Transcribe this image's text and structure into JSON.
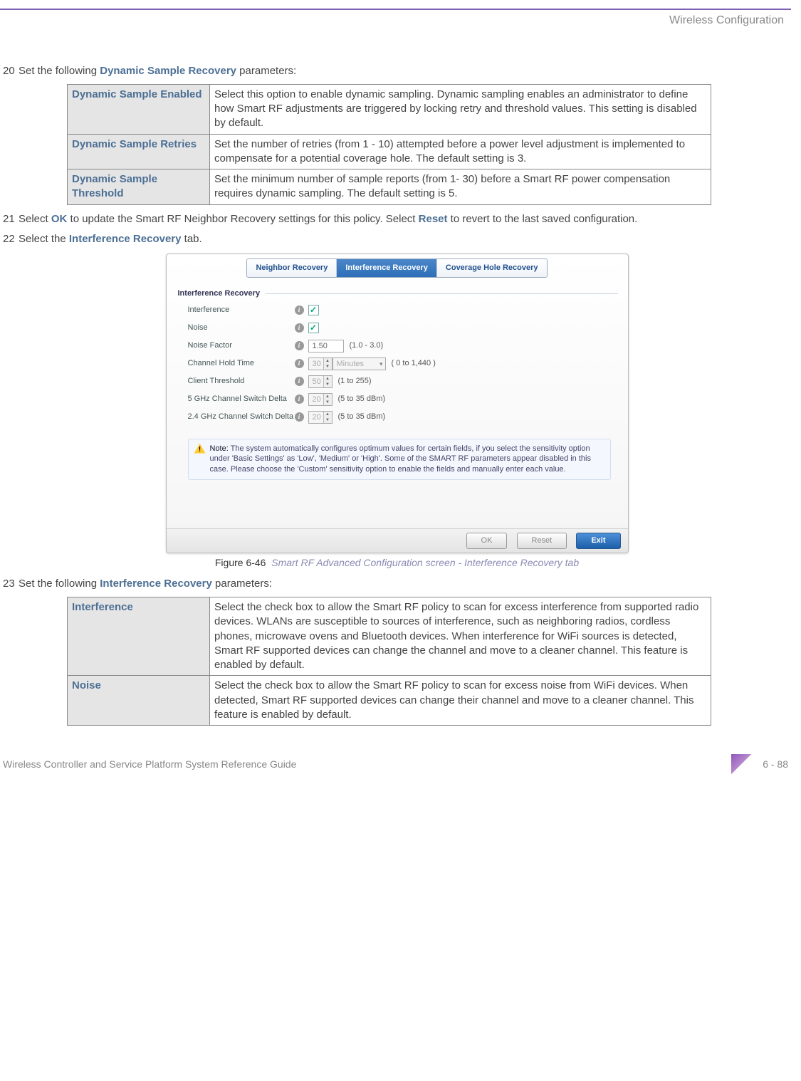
{
  "header": {
    "section_title": "Wireless Configuration"
  },
  "steps": {
    "s20": {
      "num": "20",
      "prefix": "Set the following ",
      "bold": "Dynamic Sample Recovery",
      "suffix": " parameters:"
    },
    "s21": {
      "num": "21",
      "t1": " Select ",
      "ok": "OK",
      "t2": " to update the Smart RF Neighbor Recovery settings for this policy. Select ",
      "reset": "Reset",
      "t3": " to revert to the last saved configuration."
    },
    "s22": {
      "num": "22",
      "prefix": "Select the ",
      "bold": "Interference Recovery",
      "suffix": " tab."
    },
    "s23": {
      "num": "23",
      "prefix": "Set the following ",
      "bold": "Interference Recovery",
      "suffix": " parameters:"
    }
  },
  "table1": {
    "r1": {
      "label": "Dynamic Sample Enabled",
      "desc": "Select this option to enable dynamic sampling. Dynamic sampling enables an administrator to define how Smart RF adjustments are triggered by locking retry and threshold values. This setting is disabled by default."
    },
    "r2": {
      "label": "Dynamic Sample Retries",
      "desc": "Set the number of retries (from 1 - 10) attempted before a power level adjustment is implemented to compensate for a potential coverage hole. The default setting is 3."
    },
    "r3": {
      "label": "Dynamic Sample Threshold",
      "desc": "Set the minimum number of sample reports (from 1- 30) before a Smart RF power compensation requires dynamic sampling. The default setting is 5."
    }
  },
  "table2": {
    "r1": {
      "label": "Interference",
      "desc": "Select the check box to allow the Smart RF policy to scan for excess interference from supported radio devices. WLANs are susceptible to sources of interference, such as neighboring radios, cordless phones, microwave ovens and Bluetooth devices. When interference for WiFi sources is detected, Smart RF supported devices can change the channel and move to a cleaner channel. This feature is enabled by default."
    },
    "r2": {
      "label": "Noise",
      "desc": "Select the check box to allow the Smart RF policy to scan for excess noise from WiFi devices. When detected, Smart RF supported devices can change their channel and move to a cleaner channel. This feature is enabled by default."
    }
  },
  "figure": {
    "tabs": {
      "t1": "Neighbor Recovery",
      "t2": "Interference Recovery",
      "t3": "Coverage Hole Recovery"
    },
    "fieldset_title": "Interference Recovery",
    "rows": {
      "interference": {
        "label": "Interference",
        "checked": "✓"
      },
      "noise": {
        "label": "Noise",
        "checked": "✓"
      },
      "noise_factor": {
        "label": "Noise Factor",
        "value": "1.50",
        "range": "(1.0 - 3.0)"
      },
      "hold_time": {
        "label": "Channel Hold Time",
        "value": "30",
        "unit": "Minutes",
        "range": "( 0 to 1,440 )"
      },
      "client_threshold": {
        "label": "Client Threshold",
        "value": "50",
        "range": "(1 to 255)"
      },
      "switch5": {
        "label": "5 GHz Channel Switch Delta",
        "value": "20",
        "range": "(5 to 35 dBm)"
      },
      "switch24": {
        "label": "2.4 GHz Channel Switch Delta",
        "value": "20",
        "range": "(5 to 35 dBm)"
      }
    },
    "note_bold": "Note:",
    "note_text": " The system automatically configures optimum values for certain fields, if you select the sensitivity option under 'Basic Settings' as 'Low', 'Medium' or 'High'. Some of the SMART RF parameters appear disabled in this case. Please choose the 'Custom' sensitivity option to enable the fields and manually enter each value.",
    "buttons": {
      "ok": "OK",
      "reset": "Reset",
      "exit": "Exit"
    },
    "caption_label": "Figure 6-46",
    "caption_text": "Smart RF Advanced Configuration screen - Interference Recovery tab"
  },
  "footer": {
    "left": "Wireless Controller and Service Platform System Reference Guide",
    "right": "6 - 88"
  }
}
